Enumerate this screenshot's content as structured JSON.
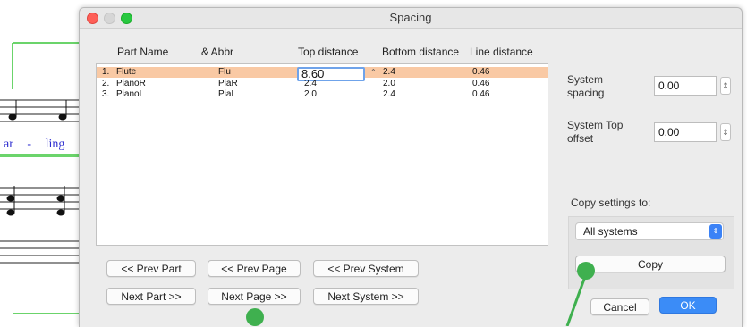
{
  "window": {
    "title": "Spacing"
  },
  "table": {
    "headers": [
      "Part Name",
      "& Abbr",
      "Top distance",
      "Bottom distance",
      "Line distance"
    ],
    "rows": [
      {
        "num": "1.",
        "name": "Flute",
        "abbr": "Flu",
        "top": "8.60",
        "bottom": "2.4",
        "line": "0.46"
      },
      {
        "num": "2.",
        "name": "PianoR",
        "abbr": "PiaR",
        "top": "2.4",
        "bottom": "2.0",
        "line": "0.46"
      },
      {
        "num": "3.",
        "name": "PianoL",
        "abbr": "PiaL",
        "top": "2.0",
        "bottom": "2.4",
        "line": "0.46"
      }
    ]
  },
  "nav": {
    "prev_part": "<< Prev Part",
    "prev_page": "<< Prev Page",
    "prev_system": "<< Prev System",
    "next_part": "Next Part >>",
    "next_page": "Next Page >>",
    "next_system": "Next System >>"
  },
  "system": {
    "spacing_label": "System spacing",
    "spacing_value": "0.00",
    "top_offset_label": "System Top offset",
    "top_offset_value": "0.00"
  },
  "copy": {
    "label": "Copy settings to:",
    "selected": "All systems",
    "button": "Copy"
  },
  "footer": {
    "cancel": "Cancel",
    "ok": "OK"
  },
  "score": {
    "lyrics": [
      "ar",
      "-",
      "ling"
    ]
  },
  "colors": {
    "accent": "#3b8cf7",
    "selection": "#f9c9a4",
    "annotation_dot": "#3fb04f",
    "lyric": "#2c2ccf"
  }
}
